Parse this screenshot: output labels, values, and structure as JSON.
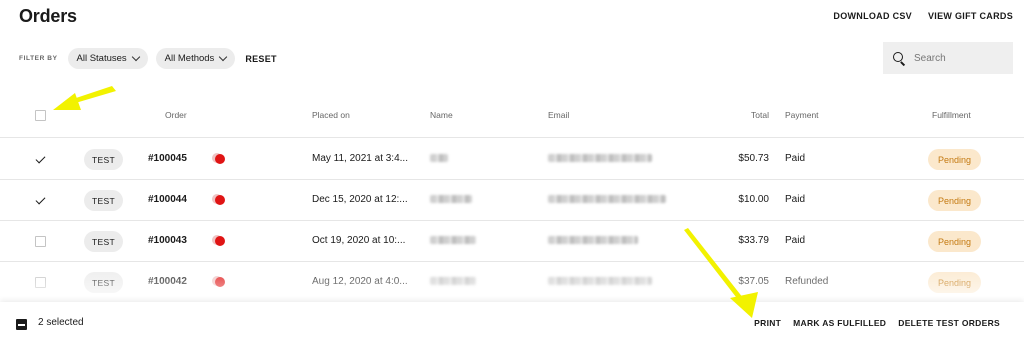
{
  "header": {
    "title": "Orders",
    "actions": [
      "DOWNLOAD CSV",
      "VIEW GIFT CARDS"
    ]
  },
  "filters": {
    "label": "FILTER BY",
    "status": "All Statuses",
    "method": "All Methods",
    "reset": "RESET"
  },
  "search": {
    "placeholder": "Search",
    "icon": "search-icon"
  },
  "table": {
    "columns": {
      "order": "Order",
      "placed_on": "Placed on",
      "name": "Name",
      "email": "Email",
      "total": "Total",
      "payment": "Payment",
      "fulfillment": "Fulfillment"
    },
    "rows": [
      {
        "checked": true,
        "badge": "TEST",
        "order": "#100045",
        "placed_on": "May 11, 2021 at 3:4...",
        "total": "$50.73",
        "payment": "Paid",
        "fulfillment": "Pending"
      },
      {
        "checked": true,
        "badge": "TEST",
        "order": "#100044",
        "placed_on": "Dec 15, 2020 at 12:...",
        "total": "$10.00",
        "payment": "Paid",
        "fulfillment": "Pending"
      },
      {
        "checked": false,
        "badge": "TEST",
        "order": "#100043",
        "placed_on": "Oct 19, 2020 at 10:...",
        "total": "$33.79",
        "payment": "Paid",
        "fulfillment": "Pending"
      },
      {
        "checked": false,
        "badge": "TEST",
        "order": "#100042",
        "placed_on": "Aug 12, 2020 at 4:0...",
        "total": "$37.05",
        "payment": "Refunded",
        "fulfillment": "Pending"
      }
    ]
  },
  "bottom_bar": {
    "selected": "2 selected",
    "actions": [
      "PRINT",
      "MARK AS FULFILLED",
      "DELETE TEST ORDERS"
    ]
  },
  "colors": {
    "pending_bg": "#fbe8cc",
    "pending_text": "#c47a12",
    "status_dot": "#e01414",
    "annotation_arrow": "#f2f200"
  }
}
